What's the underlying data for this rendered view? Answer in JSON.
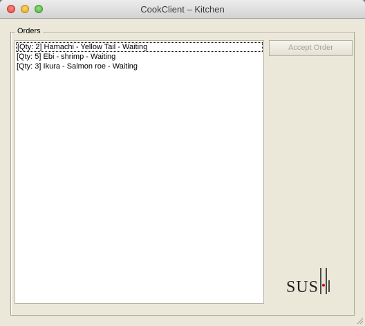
{
  "window": {
    "title": "CookClient – Kitchen"
  },
  "orders": {
    "group_label": "Orders",
    "items": [
      "[Qty: 2] Hamachi - Yellow Tail - Waiting",
      "[Qty: 5] Ebi - shrimp - Waiting",
      "[Qty: 3] Ikura - Salmon roe - Waiting"
    ],
    "accept_label": "Accept Order"
  },
  "logo": {
    "text": "SUSHI",
    "icon": "sushi-logo-icon",
    "accent_color": "#d0021b"
  }
}
